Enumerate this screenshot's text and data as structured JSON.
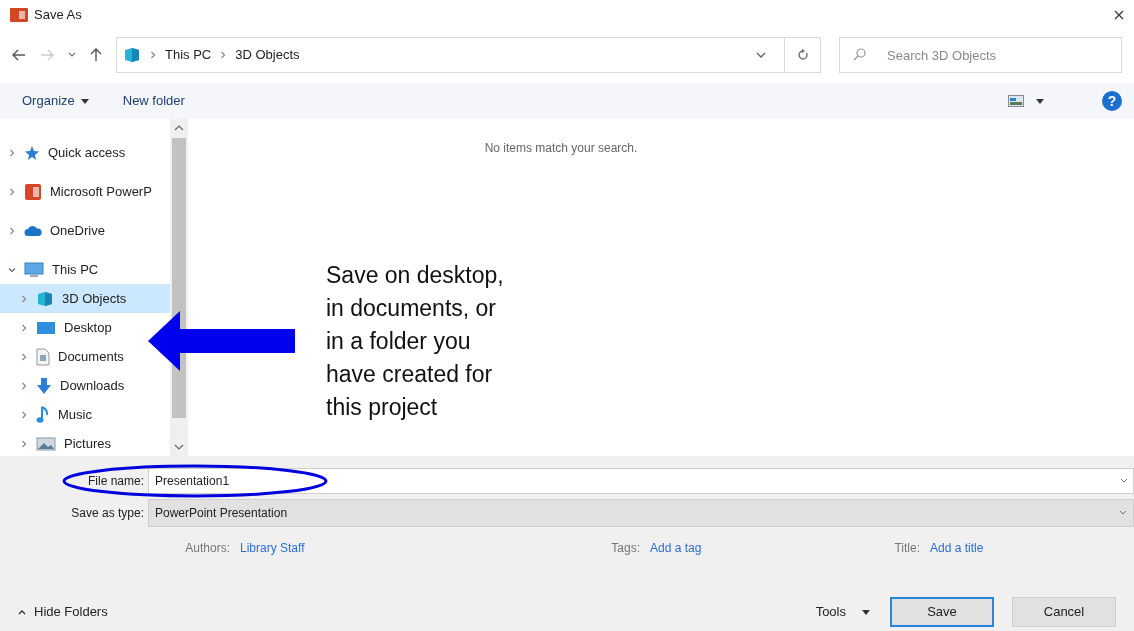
{
  "window": {
    "title": "Save As"
  },
  "address": {
    "path": [
      "This PC",
      "3D Objects"
    ]
  },
  "search": {
    "placeholder": "Search 3D Objects"
  },
  "toolbar": {
    "organize": "Organize",
    "new_folder": "New folder",
    "help": "?"
  },
  "sidebar": {
    "items": [
      {
        "label": "Quick access",
        "kind": "star",
        "expanded": false,
        "selected": false
      },
      {
        "label": "Microsoft PowerP",
        "kind": "app",
        "expanded": false,
        "selected": false
      },
      {
        "label": "OneDrive",
        "kind": "cloud",
        "expanded": false,
        "selected": false
      },
      {
        "label": "This PC",
        "kind": "pc",
        "expanded": true,
        "selected": false,
        "children": [
          {
            "label": "3D Objects",
            "kind": "cube",
            "expanded": false,
            "selected": true
          },
          {
            "label": "Desktop",
            "kind": "desktop",
            "expanded": false,
            "selected": false
          },
          {
            "label": "Documents",
            "kind": "document",
            "expanded": false,
            "selected": false
          },
          {
            "label": "Downloads",
            "kind": "download",
            "expanded": false,
            "selected": false
          },
          {
            "label": "Music",
            "kind": "music",
            "expanded": false,
            "selected": false
          },
          {
            "label": "Pictures",
            "kind": "picture",
            "expanded": false,
            "selected": false
          }
        ]
      }
    ]
  },
  "content": {
    "empty_message": "No items match your search."
  },
  "annotation": {
    "note": "Save on desktop,\nin documents, or\nin a folder you\nhave created for\nthis project"
  },
  "form": {
    "file_name_label": "File name:",
    "file_name": "Presentation1",
    "type_label": "Save as type:",
    "type": "PowerPoint Presentation"
  },
  "metadata": [
    {
      "label": "Authors:",
      "value": "Library Staff"
    },
    {
      "label": "Tags:",
      "value": "Add a tag"
    },
    {
      "label": "Title:",
      "value": "Add a title"
    }
  ],
  "footer": {
    "hide_folders": "Hide Folders",
    "tools": "Tools",
    "save": "Save",
    "cancel": "Cancel"
  }
}
